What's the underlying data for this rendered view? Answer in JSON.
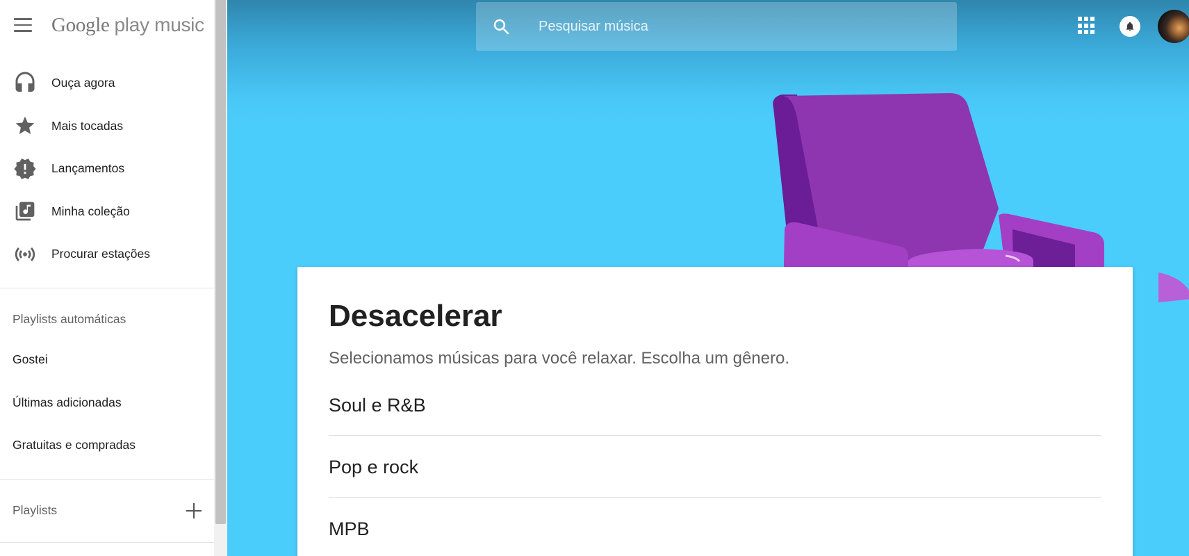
{
  "app": {
    "logo_google": "Google",
    "logo_product": "play music"
  },
  "sidebar": {
    "nav": [
      {
        "label": "Ouça agora",
        "icon": "headphones-icon"
      },
      {
        "label": "Mais tocadas",
        "icon": "star-icon"
      },
      {
        "label": "Lançamentos",
        "icon": "new-releases-icon"
      },
      {
        "label": "Minha coleção",
        "icon": "library-music-icon"
      },
      {
        "label": "Procurar estações",
        "icon": "radio-icon"
      }
    ],
    "auto_playlists_title": "Playlists automáticas",
    "auto_playlists": [
      {
        "label": "Gostei"
      },
      {
        "label": "Últimas adicionadas"
      },
      {
        "label": "Gratuitas e compradas"
      }
    ],
    "playlists_title": "Playlists"
  },
  "header": {
    "search_placeholder": "Pesquisar música"
  },
  "card": {
    "title": "Desacelerar",
    "subtitle": "Selecionamos músicas para você relaxar. Escolha um gênero.",
    "genres": [
      {
        "label": "Soul e R&B"
      },
      {
        "label": "Pop e rock"
      },
      {
        "label": "MPB"
      }
    ]
  },
  "colors": {
    "hero_background": "#4bcdfc",
    "chair_purple": "#8e36b0",
    "sidebar_bg": "#ffffff"
  }
}
